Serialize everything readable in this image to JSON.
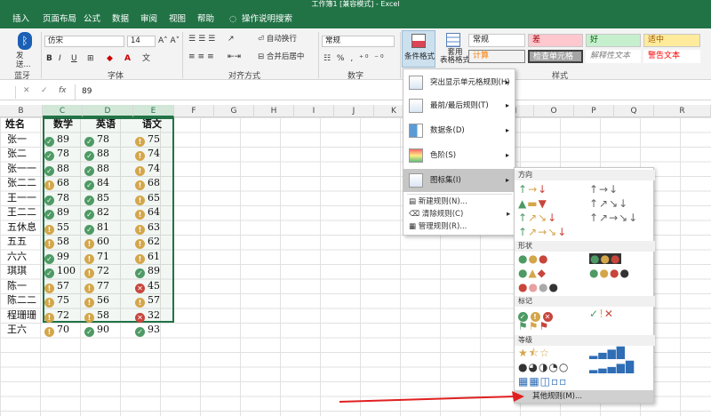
{
  "title_bar": {
    "text": "工作簿1 [兼容模式] - Excel"
  },
  "menu": {
    "items": [
      "插入",
      "页面布局",
      "公式",
      "数据",
      "审阅",
      "视图",
      "帮助",
      "操作说明搜索"
    ]
  },
  "ribbon": {
    "bluetooth_label": "发送...",
    "bluetooth_group": "蓝牙",
    "font_name": "仿宋",
    "font_size": "14",
    "font_group": "字体",
    "wrap_text": "自动换行",
    "merge_center": "合并后居中",
    "align_group": "对齐方式",
    "number_format": "常规",
    "number_group": "数字",
    "cond_format": "条件格式",
    "table_format": "套用\n表格格式",
    "styles": [
      "常规",
      "差",
      "好",
      "适中",
      "计算",
      "检查单元格",
      "解释性文本",
      "警告文本"
    ],
    "styles_group": "样式",
    "styles_colors": {
      "bad": "#ffc7ce",
      "good": "#c6efce",
      "neutral": "#ffeb9c",
      "calc": "#f2f2f2",
      "check": "#a5a5a5"
    }
  },
  "formula_bar": {
    "name_box": "",
    "value": "89"
  },
  "columns": [
    "B",
    "C",
    "D",
    "E",
    "F",
    "G",
    "H",
    "I",
    "J",
    "K",
    "L",
    "M",
    "N",
    "O",
    "P",
    "Q",
    "R"
  ],
  "table": {
    "headers": [
      "姓名",
      "数学",
      "英语",
      "语文"
    ],
    "rows": [
      {
        "name": "张一",
        "math": "89",
        "mi": "check",
        "eng": "78",
        "ei": "check",
        "chn": "75",
        "ci": "warn"
      },
      {
        "name": "张二",
        "math": "78",
        "mi": "check",
        "eng": "88",
        "ei": "check",
        "chn": "74",
        "ci": "warn"
      },
      {
        "name": "张一一",
        "math": "88",
        "mi": "check",
        "eng": "88",
        "ei": "check",
        "chn": "74",
        "ci": "warn"
      },
      {
        "name": "张二二",
        "math": "68",
        "mi": "warn",
        "eng": "84",
        "ei": "check",
        "chn": "68",
        "ci": "warn"
      },
      {
        "name": "王一一",
        "math": "78",
        "mi": "check",
        "eng": "85",
        "ei": "check",
        "chn": "65",
        "ci": "warn"
      },
      {
        "name": "王二二",
        "math": "89",
        "mi": "check",
        "eng": "82",
        "ei": "check",
        "chn": "64",
        "ci": "warn"
      },
      {
        "name": "五休息",
        "math": "55",
        "mi": "warn",
        "eng": "81",
        "ei": "check",
        "chn": "63",
        "ci": "warn"
      },
      {
        "name": "五五",
        "math": "58",
        "mi": "warn",
        "eng": "60",
        "ei": "warn",
        "chn": "62",
        "ci": "warn"
      },
      {
        "name": "六六",
        "math": "99",
        "mi": "check",
        "eng": "71",
        "ei": "warn",
        "chn": "61",
        "ci": "warn"
      },
      {
        "name": "琪琪",
        "math": "100",
        "mi": "check",
        "eng": "72",
        "ei": "warn",
        "chn": "89",
        "ci": "check"
      },
      {
        "name": "陈一",
        "math": "57",
        "mi": "warn",
        "eng": "77",
        "ei": "warn",
        "chn": "45",
        "ci": "cross"
      },
      {
        "name": "陈二二",
        "math": "75",
        "mi": "warn",
        "eng": "56",
        "ei": "warn",
        "chn": "57",
        "ci": "warn"
      },
      {
        "name": "程珊珊",
        "math": "72",
        "mi": "warn",
        "eng": "58",
        "ei": "warn",
        "chn": "32",
        "ci": "cross"
      },
      {
        "name": "王六",
        "math": "70",
        "mi": "warn",
        "eng": "90",
        "ei": "check",
        "chn": "93",
        "ci": "check"
      }
    ]
  },
  "cf_menu": {
    "items": [
      "突出显示单元格规则(H)",
      "最前/最后规则(T)",
      "数据条(D)",
      "色阶(S)",
      "图标集(I)"
    ],
    "links": [
      "新建规则(N)...",
      "清除规则(C)",
      "管理规则(R)..."
    ]
  },
  "iconset_menu": {
    "sections": [
      "方向",
      "形状",
      "标记",
      "等级"
    ],
    "more_rules": "其他规则(M)..."
  }
}
